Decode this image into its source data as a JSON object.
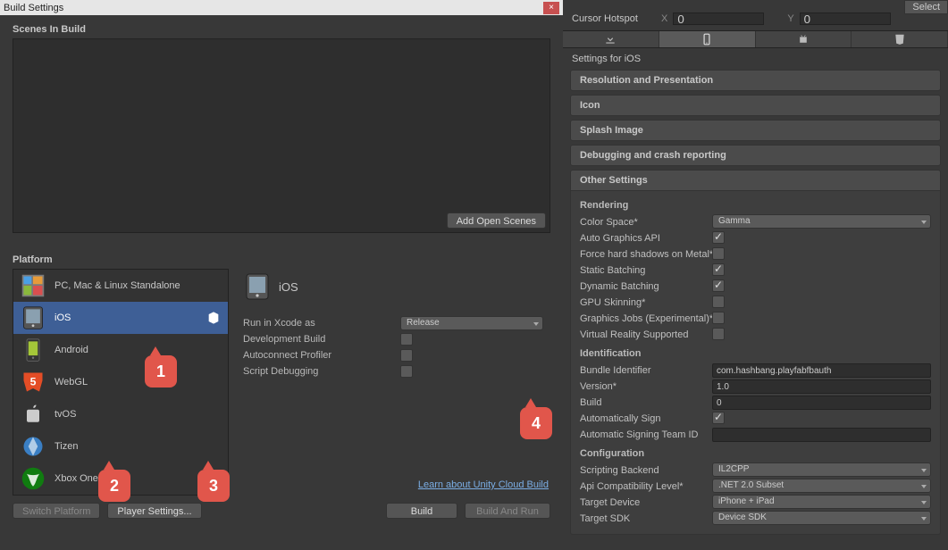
{
  "window": {
    "title": "Build Settings",
    "close": "×"
  },
  "scenes": {
    "header": "Scenes In Build",
    "add_open": "Add Open Scenes"
  },
  "platform": {
    "header": "Platform",
    "items": [
      {
        "label": "PC, Mac & Linux Standalone"
      },
      {
        "label": "iOS"
      },
      {
        "label": "Android"
      },
      {
        "label": "WebGL"
      },
      {
        "label": "tvOS"
      },
      {
        "label": "Tizen"
      },
      {
        "label": "Xbox One"
      }
    ],
    "detail": {
      "title": "iOS",
      "run_in_xcode": "Run in Xcode as",
      "run_in_xcode_value": "Release",
      "dev_build": "Development Build",
      "auto_profiler": "Autoconnect Profiler",
      "script_debug": "Script Debugging",
      "cloud_link": "Learn about Unity Cloud Build"
    }
  },
  "buttons": {
    "switch_platform": "Switch Platform",
    "player_settings": "Player Settings...",
    "build": "Build",
    "build_run": "Build And Run"
  },
  "inspector": {
    "select": "Select",
    "hotspot_label": "Cursor Hotspot",
    "x_label": "X",
    "x_value": "0",
    "y_label": "Y",
    "y_value": "0",
    "settings_for": "Settings for iOS",
    "sections": {
      "resolution": "Resolution and Presentation",
      "icon": "Icon",
      "splash": "Splash Image",
      "debugging": "Debugging and crash reporting",
      "other": "Other Settings"
    },
    "rendering": {
      "head": "Rendering",
      "color_space": "Color Space*",
      "color_space_value": "Gamma",
      "auto_graphics": "Auto Graphics API",
      "force_hard": "Force hard shadows on Metal*",
      "static_batch": "Static Batching",
      "dynamic_batch": "Dynamic Batching",
      "gpu_skin": "GPU Skinning*",
      "graphics_jobs": "Graphics Jobs (Experimental)*",
      "vr_supported": "Virtual Reality Supported"
    },
    "identification": {
      "head": "Identification",
      "bundle": "Bundle Identifier",
      "bundle_value": "com.hashbang.playfabfbauth",
      "version": "Version*",
      "version_value": "1.0",
      "build": "Build",
      "build_value": "0",
      "auto_sign": "Automatically Sign",
      "team": "Automatic Signing Team ID",
      "team_value": ""
    },
    "configuration": {
      "head": "Configuration",
      "backend": "Scripting Backend",
      "backend_value": "IL2CPP",
      "api_compat": "Api Compatibility Level*",
      "api_compat_value": ".NET 2.0 Subset",
      "target_device": "Target Device",
      "target_device_value": "iPhone + iPad",
      "target_sdk": "Target SDK",
      "target_sdk_value": "Device SDK"
    }
  },
  "callouts": {
    "c1": "1",
    "c2": "2",
    "c3": "3",
    "c4": "4"
  }
}
